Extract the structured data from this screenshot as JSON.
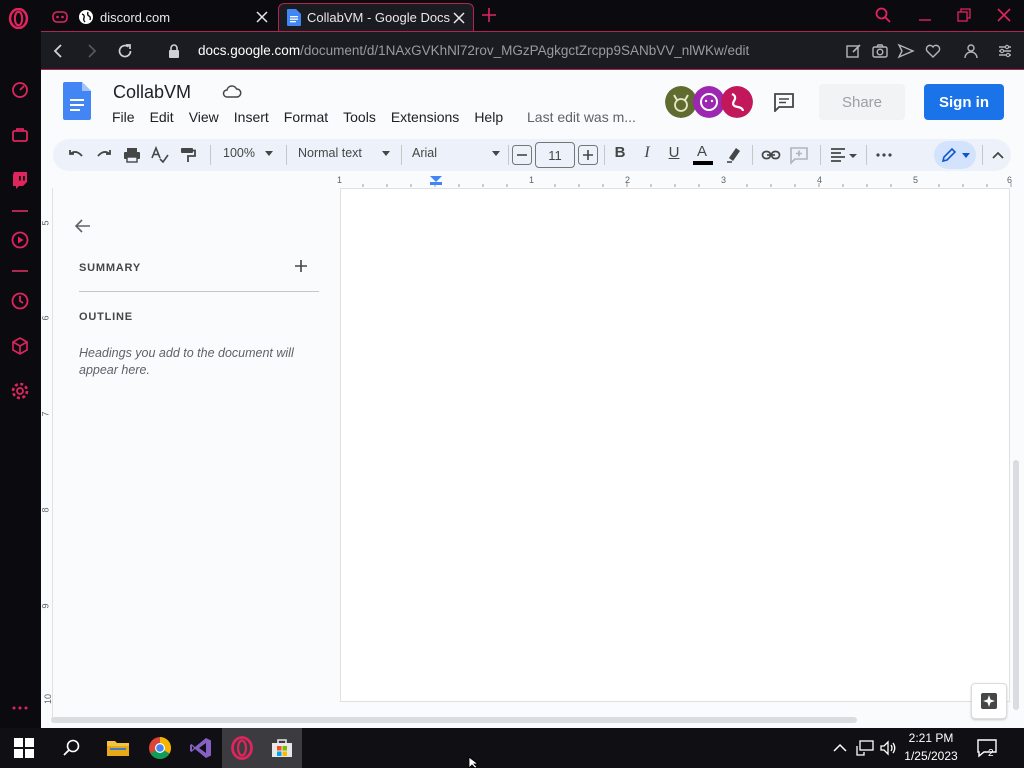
{
  "browser": {
    "tabs": [
      {
        "title": "discord.com",
        "icon": "discord-icon",
        "active": false
      },
      {
        "title": "CollabVM - Google Docs",
        "icon": "docs-icon",
        "active": true
      }
    ],
    "url_host": "docs.google.com",
    "url_path": "/document/d/1NAxGVKhNl72rov_MGzPAgkgctZrcpp9SANbVV_nlWKw/edit",
    "accent_color": "#b0264e"
  },
  "docs": {
    "title": "CollabVM",
    "menu": [
      "File",
      "Edit",
      "View",
      "Insert",
      "Format",
      "Tools",
      "Extensions",
      "Help"
    ],
    "last_edit": "Last edit was m...",
    "share_label": "Share",
    "signin_label": "Sign in",
    "toolbar": {
      "zoom": "100%",
      "style": "Normal text",
      "font": "Arial",
      "font_size": "11",
      "bold": "B",
      "italic": "I",
      "underline": "U",
      "text_color": "A"
    },
    "ruler_numbers": [
      "1",
      "1",
      "2",
      "3",
      "4",
      "5",
      "6"
    ],
    "vruler_numbers": [
      "5",
      "6",
      "7",
      "8",
      "9",
      "10"
    ],
    "outline": {
      "summary": "SUMMARY",
      "outline": "OUTLINE",
      "hint": "Headings you add to the document will appear here."
    }
  },
  "taskbar": {
    "time": "2:21 PM",
    "date": "1/25/2023",
    "notifications": "2"
  }
}
